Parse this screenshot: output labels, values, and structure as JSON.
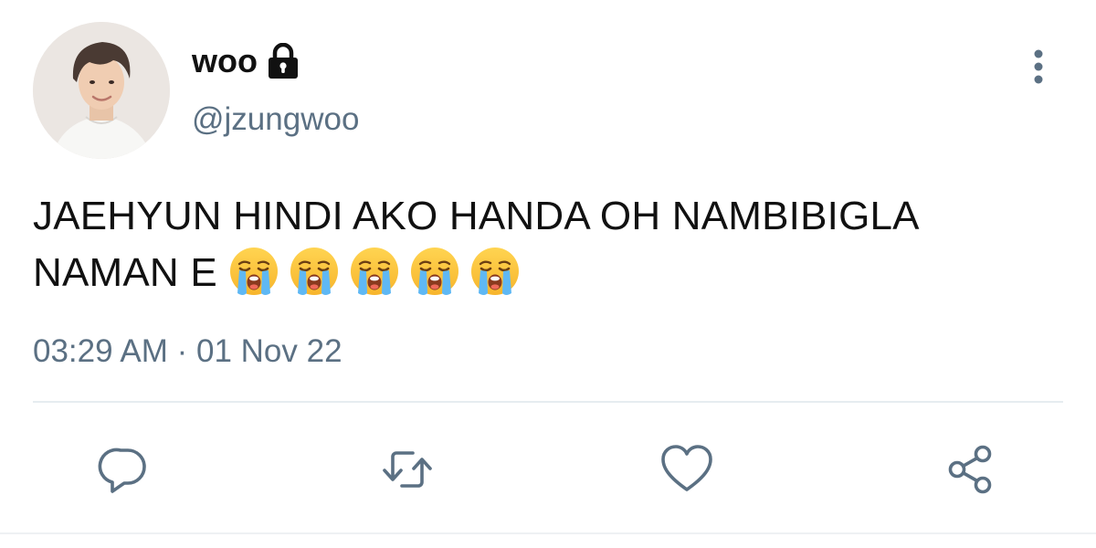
{
  "tweet": {
    "display_name": "woo",
    "handle": "@jzungwoo",
    "text_line1": "JAEHYUN HINDI AKO HANDA OH NAMBIBIGLA",
    "text_line2": "NAMAN E",
    "emojis": [
      "loudly-crying-face",
      "loudly-crying-face",
      "loudly-crying-face",
      "loudly-crying-face",
      "loudly-crying-face"
    ],
    "timestamp": "03:29 AM · 01 Nov 22"
  },
  "icons": {
    "lock": "lock-icon",
    "more": "more-vertical-icon",
    "reply": "reply-icon",
    "retweet": "retweet-icon",
    "like": "heart-icon",
    "share": "share-icon"
  },
  "colors": {
    "text": "#111111",
    "secondary": "#5b7083",
    "divider": "#e6ecf0"
  }
}
